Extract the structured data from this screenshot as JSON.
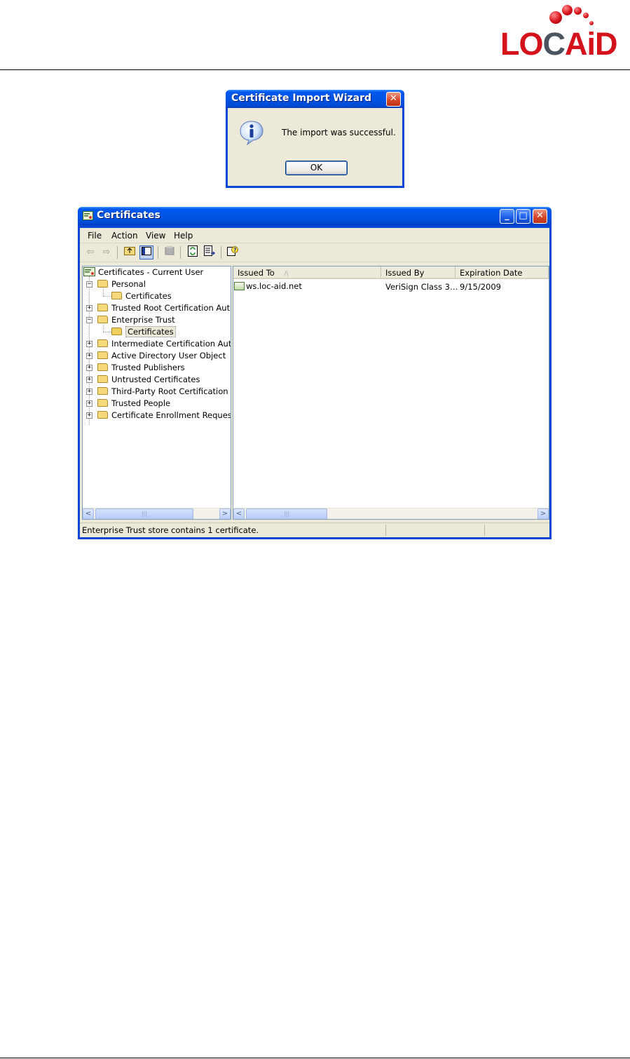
{
  "logo": {
    "part1": "LO",
    "part2": "C",
    "part3": "AiD"
  },
  "dialog": {
    "title": "Certificate Import Wizard",
    "message": "The import was successful.",
    "ok_label": "OK",
    "close_glyph": "✕"
  },
  "window": {
    "title": "Certificates",
    "controls": {
      "minimize": "_",
      "maximize": "□",
      "close": "✕"
    },
    "menu": [
      "File",
      "Action",
      "View",
      "Help"
    ],
    "tree": {
      "root": "Certificates - Current User",
      "items": [
        "Personal",
        "Certificates",
        "Trusted Root Certification Autho",
        "Enterprise Trust",
        "Certificates",
        "Intermediate Certification Author",
        "Active Directory User Object",
        "Trusted Publishers",
        "Untrusted Certificates",
        "Third-Party Root Certification Au",
        "Trusted People",
        "Certificate Enrollment Requests"
      ]
    },
    "list": {
      "columns": [
        "Issued To",
        "Issued By",
        "Expiration Date"
      ],
      "sort_glyph": "/\\",
      "rows": [
        {
          "issued_to": "ws.loc-aid.net",
          "issued_by": "VeriSign Class 3…",
          "expiration": "9/15/2009"
        }
      ]
    },
    "status_text": "Enterprise Trust store contains 1 certificate."
  }
}
